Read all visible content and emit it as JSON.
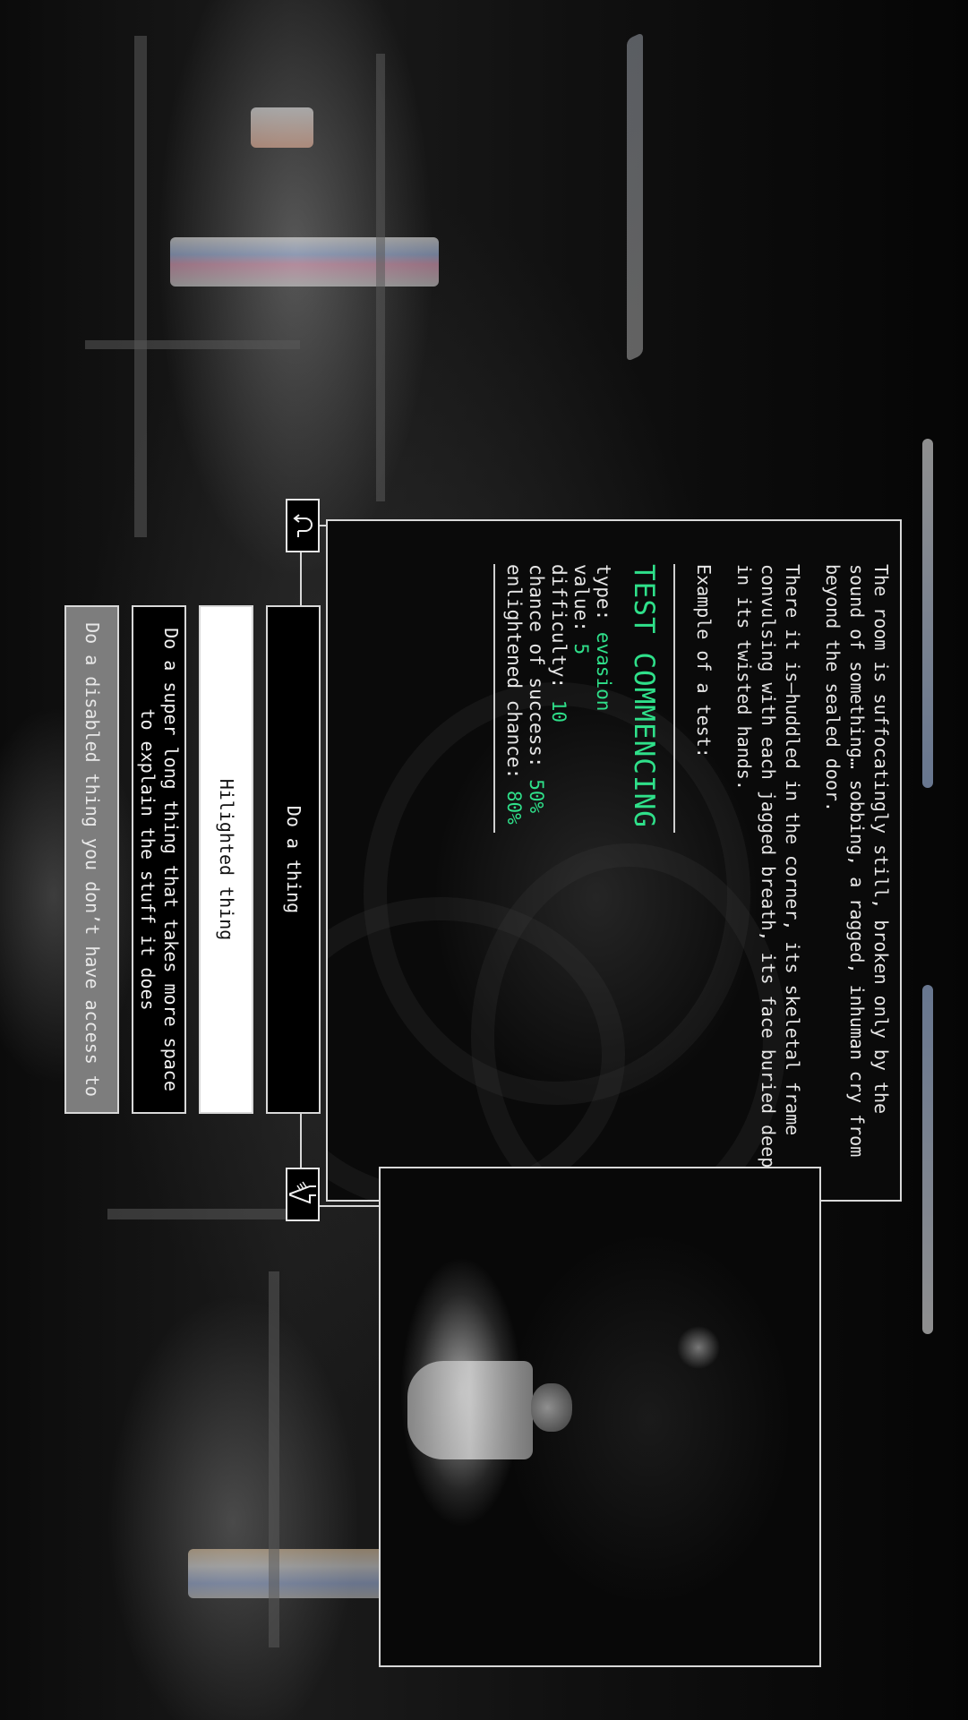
{
  "narrative": {
    "paragraph_1": "The room is suffocatingly still, broken only by the sound of something… sobbing, a ragged, inhuman cry from beyond the sealed door.",
    "paragraph_2": "There it is—huddled in the corner, its skeletal frame convulsing with each jagged breath, its face buried deep in its twisted hands.",
    "example_label": "Example of a test:"
  },
  "test": {
    "title": "TEST COMMENCING",
    "type_label": "type:",
    "type_value": "evasion",
    "value_label": "value:",
    "value_value": "5",
    "difficulty_label": "difficulty:",
    "difficulty_value": "10",
    "success_label": "chance of success:",
    "success_value": "50%",
    "enlightened_label": "enlightened chance:",
    "enlightened_value": "80%"
  },
  "choices": {
    "normal": "Do a thing",
    "highlighted": "Hilighted thing",
    "long": "Do a super long thing that takes more space to explain the stuff it does",
    "disabled": "Do a disabled thing you don’t have access to"
  },
  "icons": {
    "back": "return-arrow-icon",
    "forward": "down-arrow-icon"
  },
  "colors": {
    "accent": "#2fe08a",
    "border": "#d8d8d8",
    "disabled": "#7d7d7d"
  }
}
